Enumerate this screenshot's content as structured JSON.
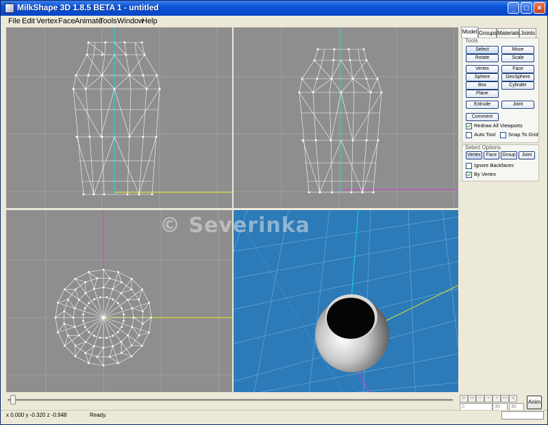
{
  "window": {
    "title": "MilkShape 3D 1.8.5 BETA 1 - untitled",
    "controls": {
      "minimize": "_",
      "maximize": "□",
      "close": "×"
    }
  },
  "menu": [
    "File",
    "Edit",
    "Vertex",
    "Face",
    "Animate",
    "Tools",
    "Window",
    "Help"
  ],
  "panel": {
    "tabs": [
      "Model",
      "Groups",
      "Materials",
      "Joints"
    ],
    "active_tab": "Model",
    "tools_legend": "Tools",
    "tools": {
      "select": "Select",
      "move": "Move",
      "rotate": "Rotate",
      "scale": "Scale",
      "vertex": "Vertex",
      "face": "Face",
      "sphere": "Sphere",
      "geosphere": "GeoSphere",
      "box": "Box",
      "cylinder": "Cylinder",
      "plane": "Plane",
      "extrude": "Extrude",
      "joint": "Joint",
      "comment": "Comment"
    },
    "redraw_all": {
      "label": "Redraw All Viewports",
      "checked": true
    },
    "auto_tool": {
      "label": "Auto Tool",
      "checked": false
    },
    "snap_to_grid": {
      "label": "Snap To Grid",
      "checked": false
    },
    "select_options": {
      "legend": "Select Options",
      "buttons": [
        "Vertex",
        "Face",
        "Group",
        "Joint"
      ],
      "ignore_backfaces": {
        "label": "Ignore Backfaces",
        "checked": false
      },
      "by_vertex": {
        "label": "By Vertex",
        "checked": true
      }
    }
  },
  "animation": {
    "button": "Anim",
    "nav_icons": [
      "first-frame-icon",
      "prev-key-icon",
      "prev-frame-icon",
      "play-icon",
      "next-frame-icon",
      "next-key-icon",
      "last-frame-icon"
    ],
    "frame_value": "0",
    "frame_count_1": "30",
    "frame_count_2": "30"
  },
  "status": {
    "coords": "x 0.000 y -0.320 z -0.948",
    "message": "Ready."
  },
  "watermark": "© Severinka",
  "colors": {
    "titlebar": "#0a53d8",
    "viewport_grey": "#8e8e8e",
    "viewport_blue": "#2c7ab8",
    "axis_cyan": "#19d9d9",
    "axis_yellow": "#e6e61f",
    "axis_magenta": "#d43fd4"
  }
}
